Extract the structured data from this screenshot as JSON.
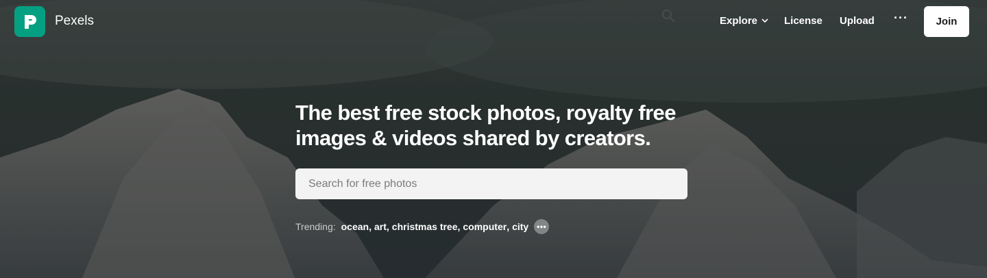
{
  "brand": {
    "name": "Pexels",
    "logo_letter": "P",
    "accent": "#05a081"
  },
  "nav": {
    "explore": "Explore",
    "license": "License",
    "upload": "Upload",
    "more": "···",
    "join": "Join"
  },
  "hero": {
    "headline": "The best free stock photos, royalty free images & videos shared by creators."
  },
  "search": {
    "placeholder": "Search for free photos",
    "value": "",
    "icon": "search-icon"
  },
  "trending": {
    "label": "Trending:",
    "items": [
      "ocean",
      "art",
      "christmas tree",
      "computer",
      "city"
    ],
    "more": "•••"
  }
}
